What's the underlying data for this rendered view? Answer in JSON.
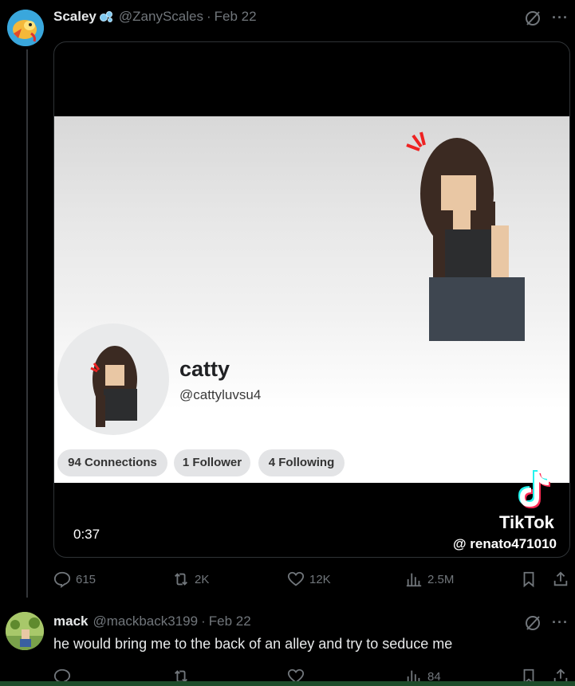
{
  "post": {
    "name": "Scaley",
    "handle": "@ZanyScales",
    "dot": "·",
    "date": "Feb 22",
    "more": "···",
    "media": {
      "profile_name": "catty",
      "profile_handle": "@cattyluvsu4",
      "connections": "94 Connections",
      "followers": "1 Follower",
      "following": "4 Following",
      "timestamp": "0:37",
      "watermark_brand": "TikTok",
      "watermark_user": "@ renato471010"
    },
    "actions": {
      "replies": "615",
      "reposts": "2K",
      "likes": "12K",
      "views": "2.5M"
    }
  },
  "reply": {
    "name": "mack",
    "handle": "@mackback3199",
    "dot": "·",
    "date": "Feb 22",
    "more": "···",
    "text": "he would bring me to the back of an alley and try to seduce me",
    "actions": {
      "views": "84"
    }
  },
  "colors": {
    "background": "#000000",
    "text": "#e7e9ea",
    "muted": "#71767b",
    "border": "#2f3336"
  },
  "icons": [
    "bubble-icon",
    "grok-icon",
    "more-icon",
    "reply-icon",
    "repost-icon",
    "like-icon",
    "views-icon",
    "bookmark-icon",
    "share-icon",
    "tiktok-icon"
  ]
}
